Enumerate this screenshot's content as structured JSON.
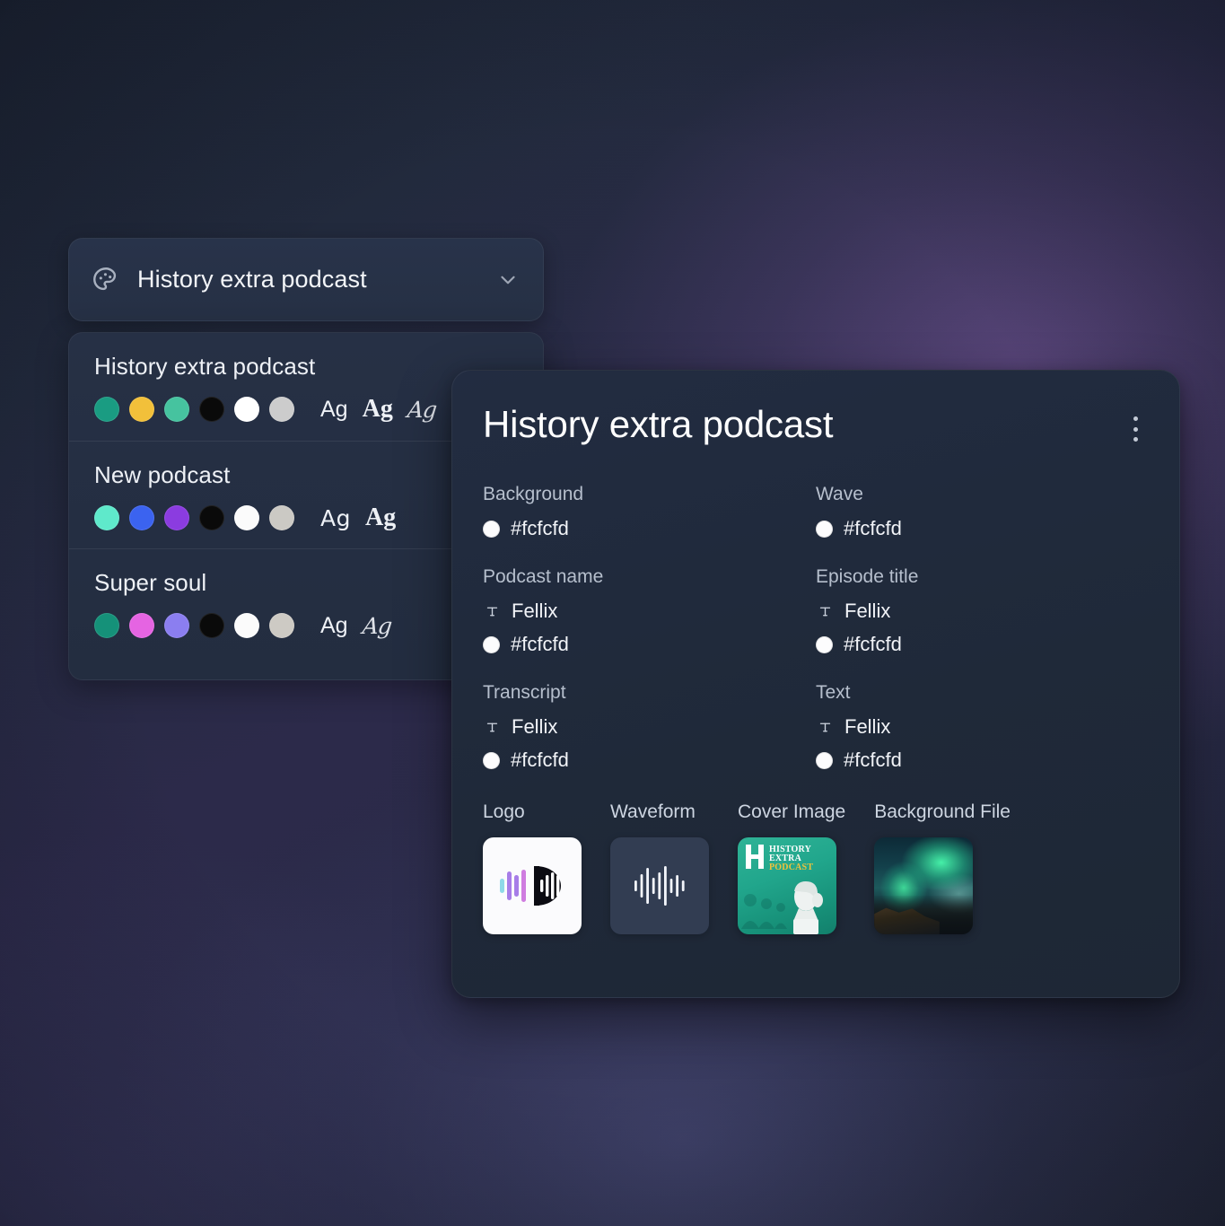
{
  "theme_selector": {
    "icon": "palette-icon",
    "selected_label": "History extra podcast",
    "chevron": "chevron-down-icon"
  },
  "theme_dropdown": {
    "options": [
      {
        "name": "History extra podcast",
        "colors": [
          "#1a9c82",
          "#f2c03a",
          "#46c39f",
          "#0a0a0a",
          "#ffffff",
          "#cccccc"
        ],
        "fonts": [
          "Ag",
          "Ag",
          "Ag"
        ],
        "font_styles": [
          "sans",
          "serif",
          "script"
        ]
      },
      {
        "name": "New podcast",
        "colors": [
          "#5fe9cb",
          "#3b63f0",
          "#8b3ce0",
          "#0a0a0a",
          "#fbfbfb",
          "#cbc9c4"
        ],
        "fonts": [
          "Ag",
          "Ag"
        ],
        "font_styles": [
          "rounded",
          "serif"
        ]
      },
      {
        "name": "Super soul",
        "colors": [
          "#159179",
          "#e564e2",
          "#8b7ef0",
          "#0a0a0a",
          "#fbfbfb",
          "#cdcac4"
        ],
        "fonts": [
          "Ag",
          "Ag"
        ],
        "font_styles": [
          "sans",
          "script"
        ]
      }
    ]
  },
  "detail_card": {
    "title": "History extra podcast",
    "menu_icon": "kebab-menu-icon",
    "properties": [
      {
        "label": "Background",
        "color": "#fcfcfd",
        "color_swatch": "#fcfcfd"
      },
      {
        "label": "Wave",
        "color": "#fcfcfd",
        "color_swatch": "#fcfcfd"
      },
      {
        "label": "Podcast name",
        "font": "Fellix",
        "color": "#fcfcfd",
        "color_swatch": "#fcfcfd"
      },
      {
        "label": "Episode title",
        "font": "Fellix",
        "color": "#fcfcfd",
        "color_swatch": "#fcfcfd"
      },
      {
        "label": "Transcript",
        "font": "Fellix",
        "color": "#fcfcfd",
        "color_swatch": "#fcfcfd"
      },
      {
        "label": "Text",
        "font": "Fellix",
        "color": "#fcfcfd",
        "color_swatch": "#fcfcfd"
      }
    ],
    "assets": [
      {
        "label": "Logo",
        "kind": "logo-thumbnail"
      },
      {
        "label": "Waveform",
        "kind": "waveform-thumbnail"
      },
      {
        "label": "Cover Image",
        "kind": "cover-image-thumbnail"
      },
      {
        "label": "Background File",
        "kind": "background-file-thumbnail"
      }
    ],
    "cover_art": {
      "line1": "HISTORY",
      "line2": "EXTRA",
      "line3": "PODCAST"
    }
  }
}
